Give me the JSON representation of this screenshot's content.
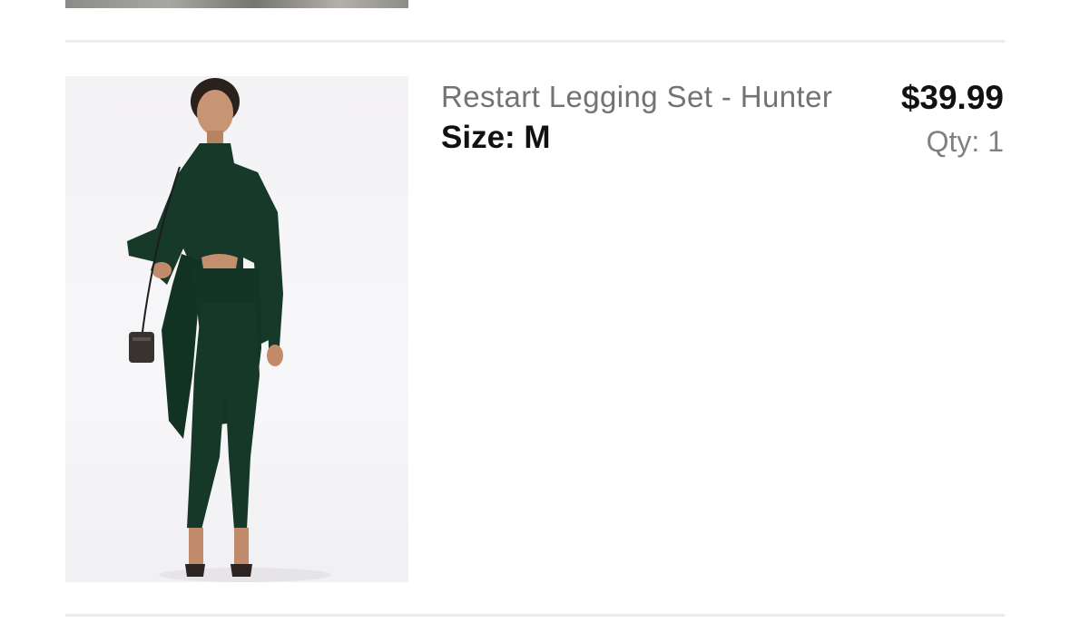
{
  "cart_item": {
    "name": "Restart Legging Set - Hunter",
    "size_label": "Size:",
    "size_value": "M",
    "price": "$39.99",
    "qty_label": "Qty:",
    "qty_value": "1",
    "product_color": "#16392a"
  },
  "colors": {
    "divider": "#ebebeb",
    "title_text": "#737373",
    "qty_text": "#808080",
    "primary_text": "#111111"
  }
}
